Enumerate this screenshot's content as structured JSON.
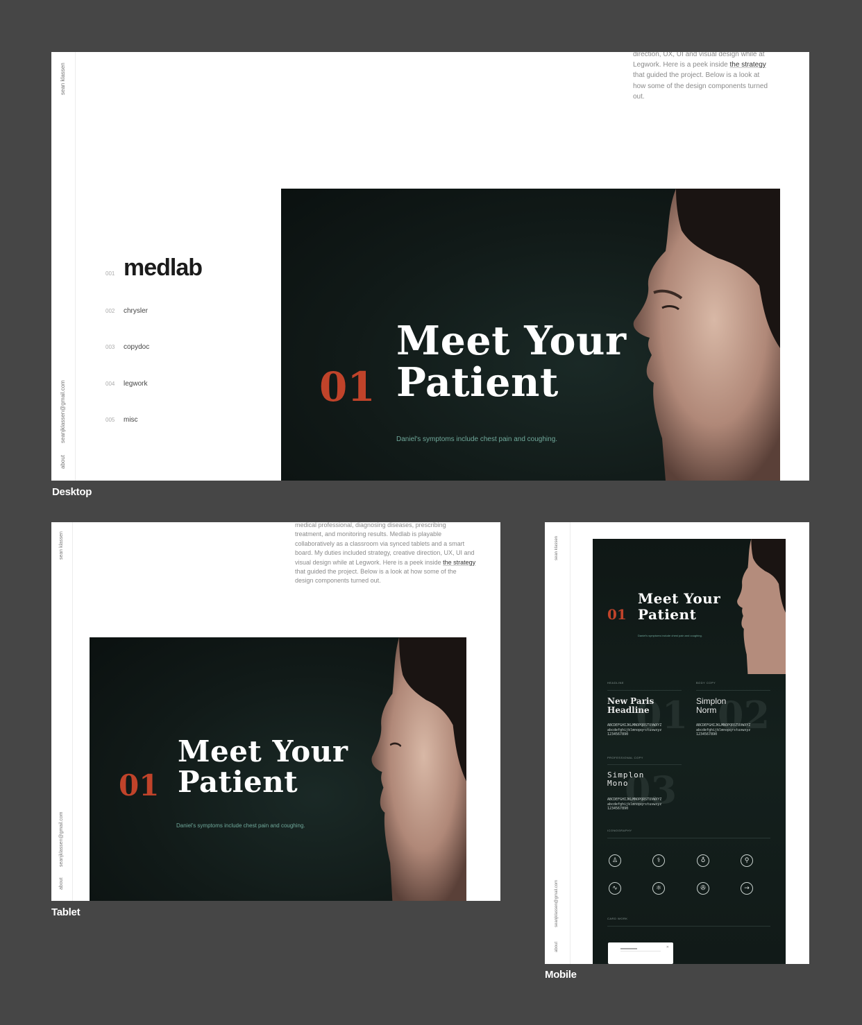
{
  "site": {
    "name": "sean klassen",
    "email": "seanjklassen@gmail.com",
    "about": "about"
  },
  "captions": {
    "desktop": "Desktop",
    "tablet": "Tablet",
    "mobile": "Mobile"
  },
  "desktop": {
    "intro_lines": [
      "direction, UX, UI and visual design while at",
      "Legwork. Here is a peek inside ",
      "that guided the project. Below is a look at",
      "how some of the design components turned",
      "out."
    ],
    "intro_link": "the strategy",
    "nav": [
      {
        "idx": "001",
        "label": "medlab"
      },
      {
        "idx": "002",
        "label": "chrysler"
      },
      {
        "idx": "003",
        "label": "copydoc"
      },
      {
        "idx": "004",
        "label": "legwork"
      },
      {
        "idx": "005",
        "label": "misc"
      }
    ]
  },
  "tablet": {
    "intro_lines": [
      "medical professional, diagnosing diseases, prescribing",
      "treatment, and monitoring results. Medlab is playable",
      "collaboratively as a classroom via synced tablets and a smart",
      "board. My duties included strategy, creative direction, UX, UI and",
      "visual design while at Legwork. Here is a peek inside ",
      "that guided the project. Below is a look at how some of the",
      "design components turned out."
    ],
    "intro_link": "the strategy"
  },
  "hero": {
    "number": "01",
    "title_line1": "Meet Your",
    "title_line2": "Patient",
    "subtitle": "Daniel's symptoms include chest pain and coughing."
  },
  "mobile": {
    "fonts": [
      {
        "label": "HEADLINE",
        "name_line1": "New Paris",
        "name_line2": "Headline",
        "big": "01"
      },
      {
        "label": "BODY COPY",
        "name_line1": "Simplon",
        "name_line2": "Norm",
        "big": "02"
      },
      {
        "label": "PROFESSIONAL COPY",
        "name_line1": "Simplon",
        "name_line2": "Mono",
        "big": "03"
      }
    ],
    "glyphs": [
      "ABCDEFGHIJKLMNOPQRSTUVWXYZ",
      "abcdefghijklmnopqrstuvwxyz",
      "1234567890"
    ],
    "iconography_label": "ICONOGRAPHY",
    "icons": [
      "♙",
      "⚕",
      "♁",
      "⚲",
      "∿",
      "⚛",
      "✇",
      "→"
    ],
    "cards_label": "CARD WORK"
  },
  "colors": {
    "background": "#464646",
    "accent": "#c0432a",
    "hero_bg": "#111a18",
    "subtitle": "#6fa89a"
  }
}
